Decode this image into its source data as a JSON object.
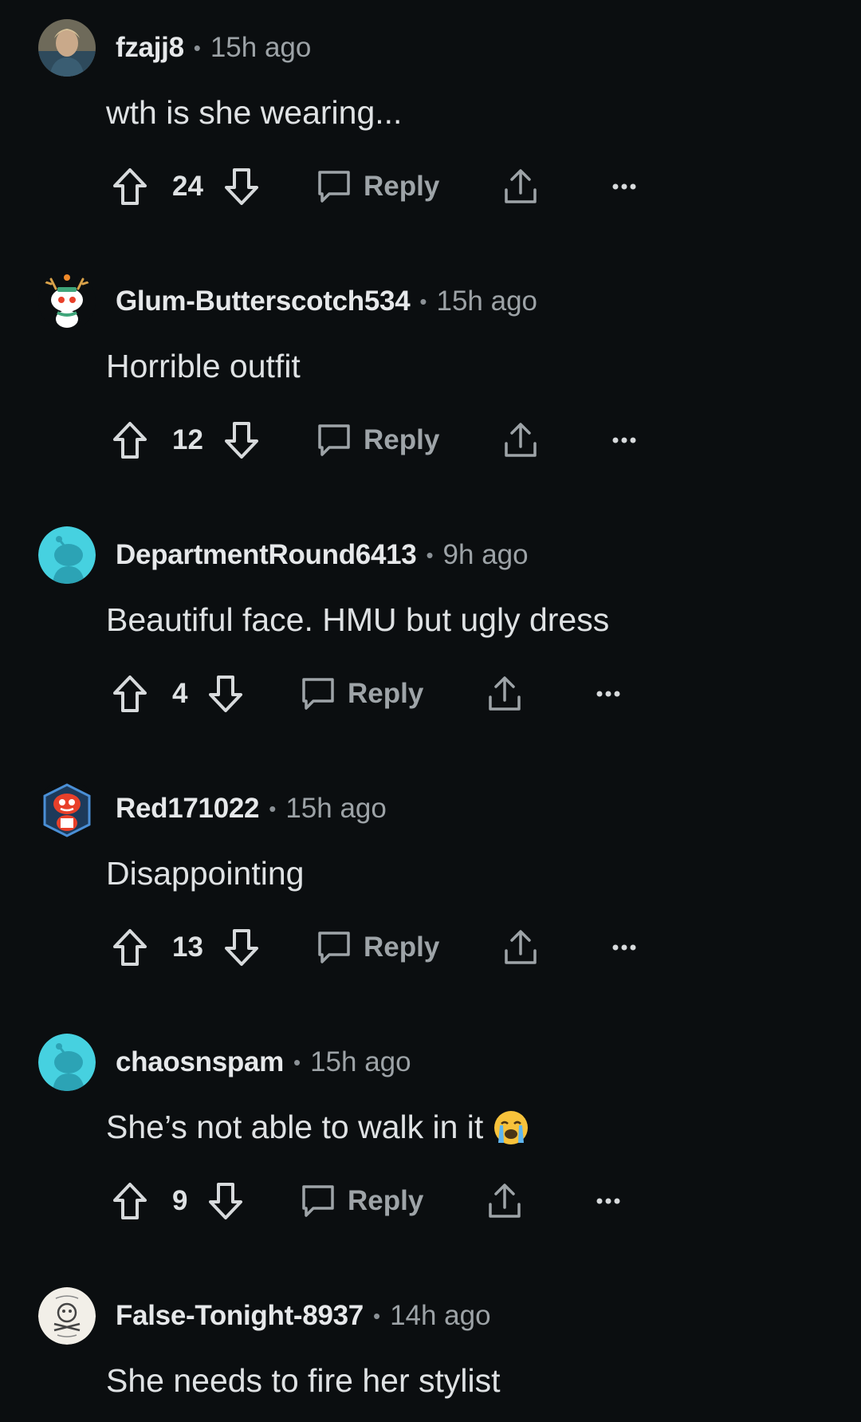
{
  "comments": [
    {
      "username": "fzajj8",
      "separator": "•",
      "time": "15h ago",
      "text": "wth is she wearing...",
      "votes": "24",
      "reply_label": "Reply",
      "avatar": "photo-avatar",
      "avatar_colors": {
        "bg": "#8a7a62",
        "face": "#c9a98a",
        "hair": "#d8c39a"
      }
    },
    {
      "username": "Glum-Butterscotch534",
      "separator": "•",
      "time": "15h ago",
      "text": "Horrible outfit",
      "votes": "12",
      "reply_label": "Reply",
      "avatar": "snoo-antlers-avatar",
      "avatar_colors": {
        "bg": "#0b0e10",
        "face": "#ffffff",
        "accent": "#3fa57a"
      }
    },
    {
      "username": "DepartmentRound6413",
      "separator": "•",
      "time": "9h ago",
      "text": "Beautiful face. HMU but ugly dress",
      "votes": "4",
      "reply_label": "Reply",
      "avatar": "default-snoo-avatar",
      "avatar_colors": {
        "bg": "#46d1e0",
        "face": "#2ca3b5"
      }
    },
    {
      "username": "Red171022",
      "separator": "•",
      "time": "15h ago",
      "text": "Disappointing",
      "votes": "13",
      "reply_label": "Reply",
      "avatar": "red-snoo-avatar",
      "avatar_colors": {
        "bg": "#0b0e10",
        "face": "#e8402a",
        "accent": "#4a8fd6"
      }
    },
    {
      "username": "chaosnspam",
      "separator": "•",
      "time": "15h ago",
      "text": "She’s not able to walk in it",
      "emoji": "crying-face-emoji",
      "votes": "9",
      "reply_label": "Reply",
      "avatar": "default-snoo-avatar",
      "avatar_colors": {
        "bg": "#46d1e0",
        "face": "#2ca3b5"
      }
    },
    {
      "username": "False-Tonight-8937",
      "separator": "•",
      "time": "14h ago",
      "text": "She needs to fire her stylist",
      "avatar": "sketch-avatar",
      "avatar_colors": {
        "bg": "#f2efe8",
        "face": "#444444"
      }
    }
  ],
  "colors": {
    "background": "#0b0e10",
    "username": "#e6e8ea",
    "meta": "#9da3a7",
    "body": "#dfe2e4",
    "icon": "#d7dadc",
    "reply": "#9ea4a8"
  }
}
